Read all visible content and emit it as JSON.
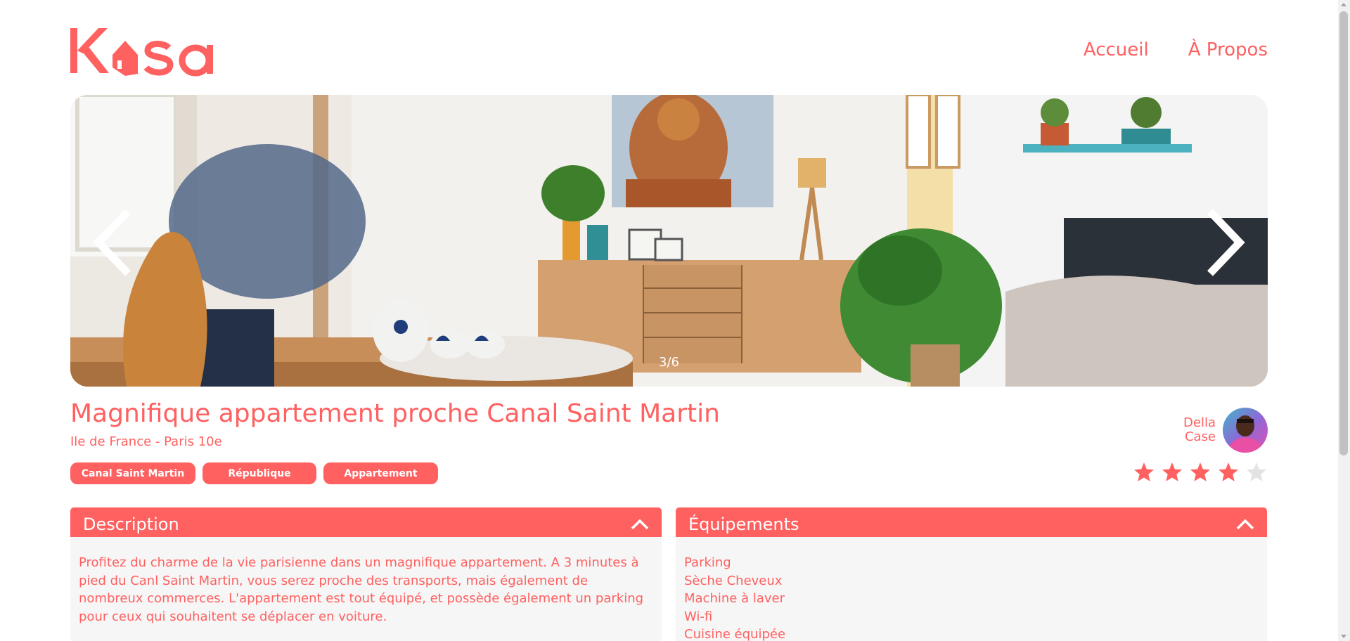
{
  "logo": {
    "text": "Kasa"
  },
  "nav": {
    "home": "Accueil",
    "about": "À Propos"
  },
  "carousel": {
    "counter": "3/6"
  },
  "listing": {
    "title": "Magnifique appartement proche Canal Saint Martin",
    "location": "Ile de France - Paris 10e",
    "tags": [
      "Canal Saint Martin",
      "République",
      "Appartement"
    ],
    "host": {
      "first_name": "Della",
      "last_name": "Case"
    },
    "rating": 4,
    "rating_max": 5
  },
  "description": {
    "title": "Description",
    "text": "Profitez du charme de la vie parisienne dans un magnifique appartement. A 3 minutes à pied du Canl Saint Martin, vous serez proche des transports, mais également de nombreux commerces. L'appartement est tout équipé, et possède également un parking pour ceux qui souhaitent se déplacer en voiture."
  },
  "equipments": {
    "title": "Équipements",
    "items": [
      "Parking",
      "Sèche Cheveux",
      "Machine à laver",
      "Wi-fi",
      "Cuisine équipée"
    ]
  },
  "colors": {
    "primary": "#FF6060",
    "panel": "#F6F6F6",
    "white": "#FFFFFF"
  }
}
